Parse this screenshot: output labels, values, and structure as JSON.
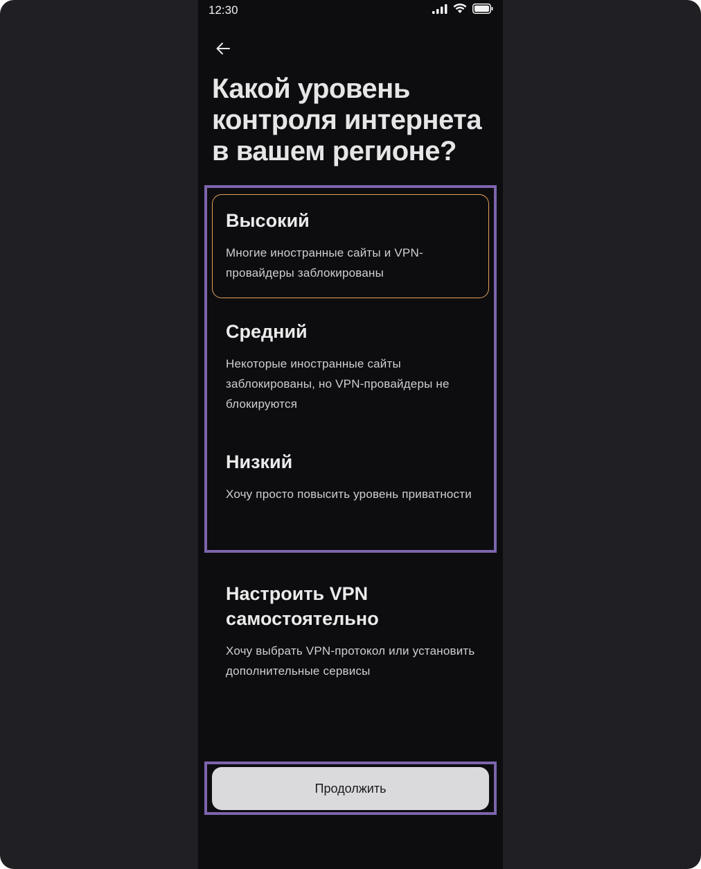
{
  "status_bar": {
    "time": "12:30",
    "icons": [
      "signal-icon",
      "wifi-icon",
      "battery-icon"
    ]
  },
  "header": {
    "back_icon": "arrow-left-icon",
    "title": "Какой уровень контроля интернета в вашем регионе?"
  },
  "options": [
    {
      "title": "Высокий",
      "description": "Многие иностранные сайты и VPN-провайдеры заблокированы",
      "selected": true
    },
    {
      "title": "Средний",
      "description": "Некоторые иностранные сайты заблокированы, но VPN-провайдеры не блокируются",
      "selected": false
    },
    {
      "title": "Низкий",
      "description": "Хочу просто повысить уровень приватности",
      "selected": false
    },
    {
      "title": "Настроить VPN самостоятельно",
      "description": "Хочу выбрать VPN-протокол или установить дополнительные сервисы",
      "selected": false
    }
  ],
  "footer": {
    "continue_label": "Продолжить"
  },
  "colors": {
    "selected_border": "#e6a15a",
    "highlight": "#7d65ad",
    "background": "#0d0d10",
    "button": "#dadadd"
  }
}
